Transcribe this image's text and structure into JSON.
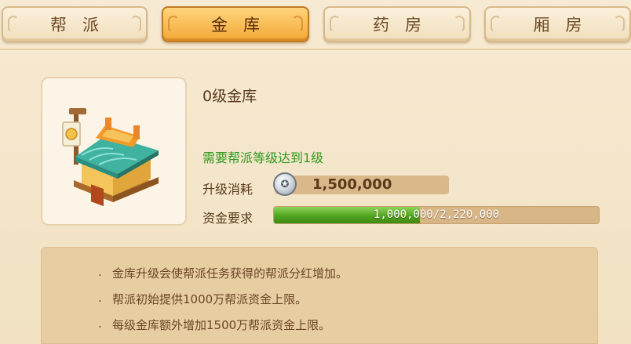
{
  "tabs": [
    {
      "label": "帮派",
      "active": false
    },
    {
      "label": "金库",
      "active": true
    },
    {
      "label": "药房",
      "active": false
    },
    {
      "label": "厢房",
      "active": false
    }
  ],
  "building": {
    "title": "0级金库",
    "requirement": "需要帮派等级达到1级",
    "upgrade_cost_label": "升级消耗",
    "upgrade_cost_value": "1,500,000",
    "coin_icon": "silver-coin-icon",
    "fund_label": "资金要求",
    "fund_text": "1,000,000/2,220,000",
    "fund_progress": 0.45
  },
  "notes": {
    "bullet": ".",
    "items": [
      "金库升级会使帮派任务获得的帮派分红增加。",
      "帮派初始提供1000万帮派资金上限。",
      "每级金库额外增加1500万帮派资金上限。"
    ]
  },
  "colors": {
    "active_tab": "#f3a839",
    "requirement_text": "#2f9a1e",
    "progress_fill": "#52a31f"
  }
}
